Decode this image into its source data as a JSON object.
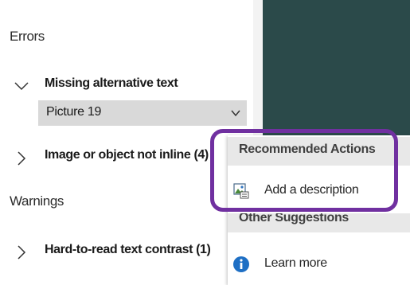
{
  "errors": {
    "heading": "Errors",
    "items": [
      {
        "label": "Missing alternative text",
        "expanded": true,
        "selected_value": "Picture 19"
      },
      {
        "label": "Image or object not inline (4)",
        "expanded": false
      }
    ]
  },
  "warnings": {
    "heading": "Warnings",
    "items": [
      {
        "label": "Hard-to-read text contrast (1)",
        "expanded": false
      }
    ]
  },
  "context_menu": {
    "recommended_title": "Recommended Actions",
    "add_description_label": "Add a description",
    "add_description_icon": "alt-text-picture-icon",
    "other_title": "Other Suggestions",
    "learn_more_label": "Learn more",
    "learn_more_icon": "info-icon"
  },
  "colors": {
    "highlight_border": "#7030a0",
    "selected_row": "#d9d9d9",
    "info_icon": "#1e6fc4",
    "background_dark": "#2b4a4a"
  }
}
